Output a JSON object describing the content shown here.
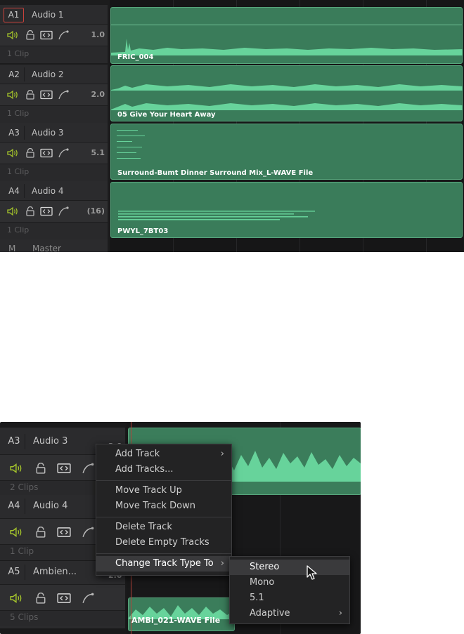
{
  "panel_top": {
    "tracks": [
      {
        "id": "A1",
        "name": "Audio 1",
        "channel": "1.0",
        "clips": "1 Clip",
        "clip_name": "FRIC_004",
        "selected": true
      },
      {
        "id": "A2",
        "name": "Audio 2",
        "channel": "2.0",
        "clips": "1 Clip",
        "clip_name": "05 Give Your Heart Away",
        "selected": false
      },
      {
        "id": "A3",
        "name": "Audio 3",
        "channel": "5.1",
        "clips": "1 Clip",
        "clip_name": "Surround-Bumt Dinner Surround Mix_L-WAVE File",
        "selected": false
      },
      {
        "id": "A4",
        "name": "Audio 4",
        "channel": "(16)",
        "clips": "1 Clip",
        "clip_name": "PWYL_7BT03",
        "selected": false
      }
    ],
    "master": {
      "id": "M",
      "name": "Master"
    }
  },
  "panel_bottom": {
    "tracks": [
      {
        "id": "A3",
        "name": "Audio 3",
        "channel": "2.0",
        "clips": "2 Clips"
      },
      {
        "id": "A4",
        "name": "Audio 4",
        "channel": "",
        "clips": "1 Clip"
      },
      {
        "id": "A5",
        "name": "Ambien...",
        "channel": "2.0",
        "clips": "5 Clips"
      }
    ],
    "clip_label": "AMBI_021-WAVE File",
    "context_menu": {
      "items": [
        "Add Track",
        "Add Tracks...",
        "Move Track Up",
        "Move Track Down",
        "Delete Track",
        "Delete Empty Tracks",
        "Change Track Type To"
      ]
    },
    "submenu": {
      "items": [
        "Stereo",
        "Mono",
        "5.1",
        "Adaptive"
      ]
    }
  },
  "colors": {
    "clip_green": "#3a7c5a",
    "waveform": "#67d39b",
    "selection_red": "#c8413b",
    "speaker_yellow_green": "#a5c52b"
  }
}
